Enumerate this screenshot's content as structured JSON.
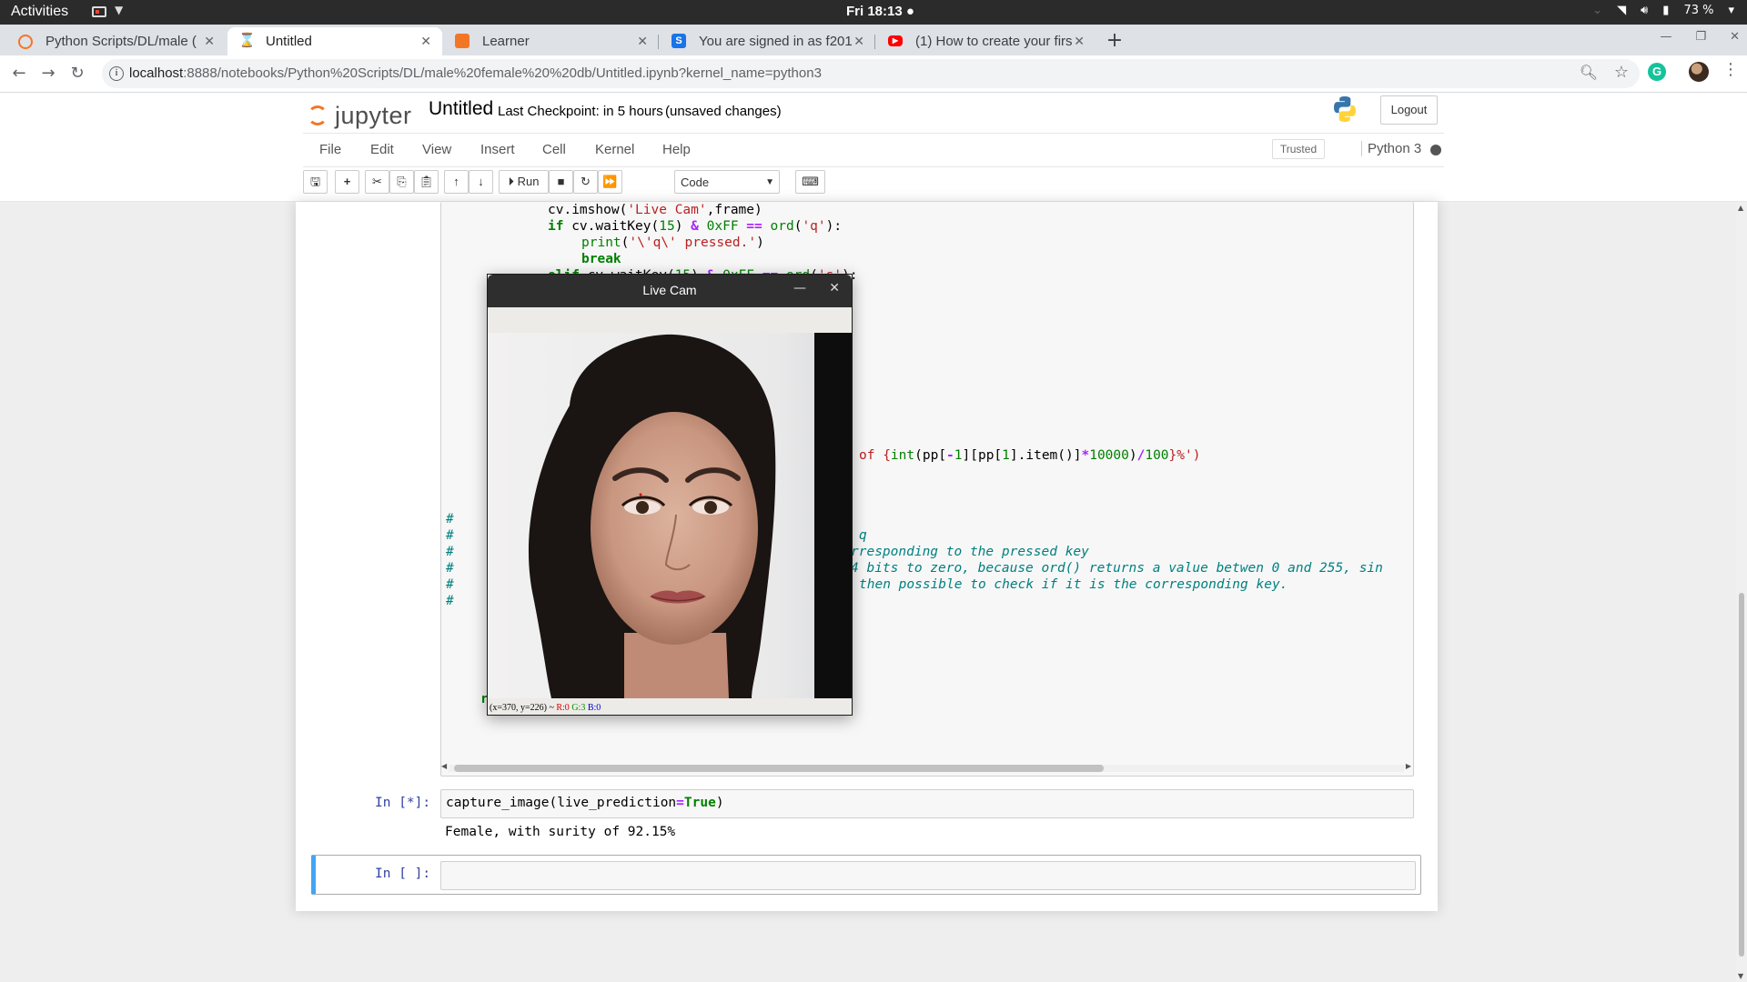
{
  "system": {
    "activities": "Activities",
    "clock": "Fri 18:13 ●",
    "battery": "73 %"
  },
  "browser": {
    "tabs": [
      {
        "title": "Python Scripts/DL/male (",
        "icon": "jupyter-favicon",
        "active": false
      },
      {
        "title": "Untitled",
        "icon": "hourglass-favicon",
        "active": true
      },
      {
        "title": "Learner",
        "icon": "learner-favicon",
        "active": false
      },
      {
        "title": "You are signed in as f201",
        "icon": "s-favicon",
        "active": false
      },
      {
        "title": "(1) How to create your firs",
        "icon": "youtube-favicon",
        "active": false
      }
    ],
    "url_host": "localhost",
    "url_path": ":8888/notebooks/Python%20Scripts/DL/male%20female%20%20db/Untitled.ipynb?kernel_name=python3"
  },
  "jupyter": {
    "logo_text": "jupyter",
    "notebook_name": "Untitled",
    "checkpoint": "Last Checkpoint: in 5 hours",
    "autosave": "(unsaved changes)",
    "logout": "Logout",
    "menu": [
      "File",
      "Edit",
      "View",
      "Insert",
      "Cell",
      "Kernel",
      "Help"
    ],
    "trusted": "Trusted",
    "kernel": "Python 3",
    "run_label": "Run",
    "cell_type": "Code"
  },
  "cell1": {
    "lines_top": [
      "cv.imshow('Live Cam',frame)",
      "if cv.waitKey(15) & 0xFF == ord('q'):",
      "print('\\'q\\' pressed.')",
      "break",
      "elif cv.waitKey(15) & 0xFF == ord('s'):"
    ],
    "fstring_fragment": "of {int(pp[-1][pp[1].item()]*10000)/100}%')",
    "comment_hash": "#",
    "comment_1": "q",
    "comment_2": "rresponding to the pressed key",
    "comment_3": "4 bits to zero, because ord() returns a value betwen 0 and 255, sin",
    "comment_4": "then possible to check if it is the corresponding key.",
    "return_line": "return img"
  },
  "cell2": {
    "prompt": "In [*]:",
    "code": "capture_image(live_prediction=True)",
    "output": "Female, with surity of 92.15%"
  },
  "cell3": {
    "prompt": "In [ ]:"
  },
  "livecam": {
    "title": "Live Cam",
    "status_coords": "(x=370, y=226) ~",
    "status_r": "R:0",
    "status_g": "G:3",
    "status_b": "B:0"
  }
}
